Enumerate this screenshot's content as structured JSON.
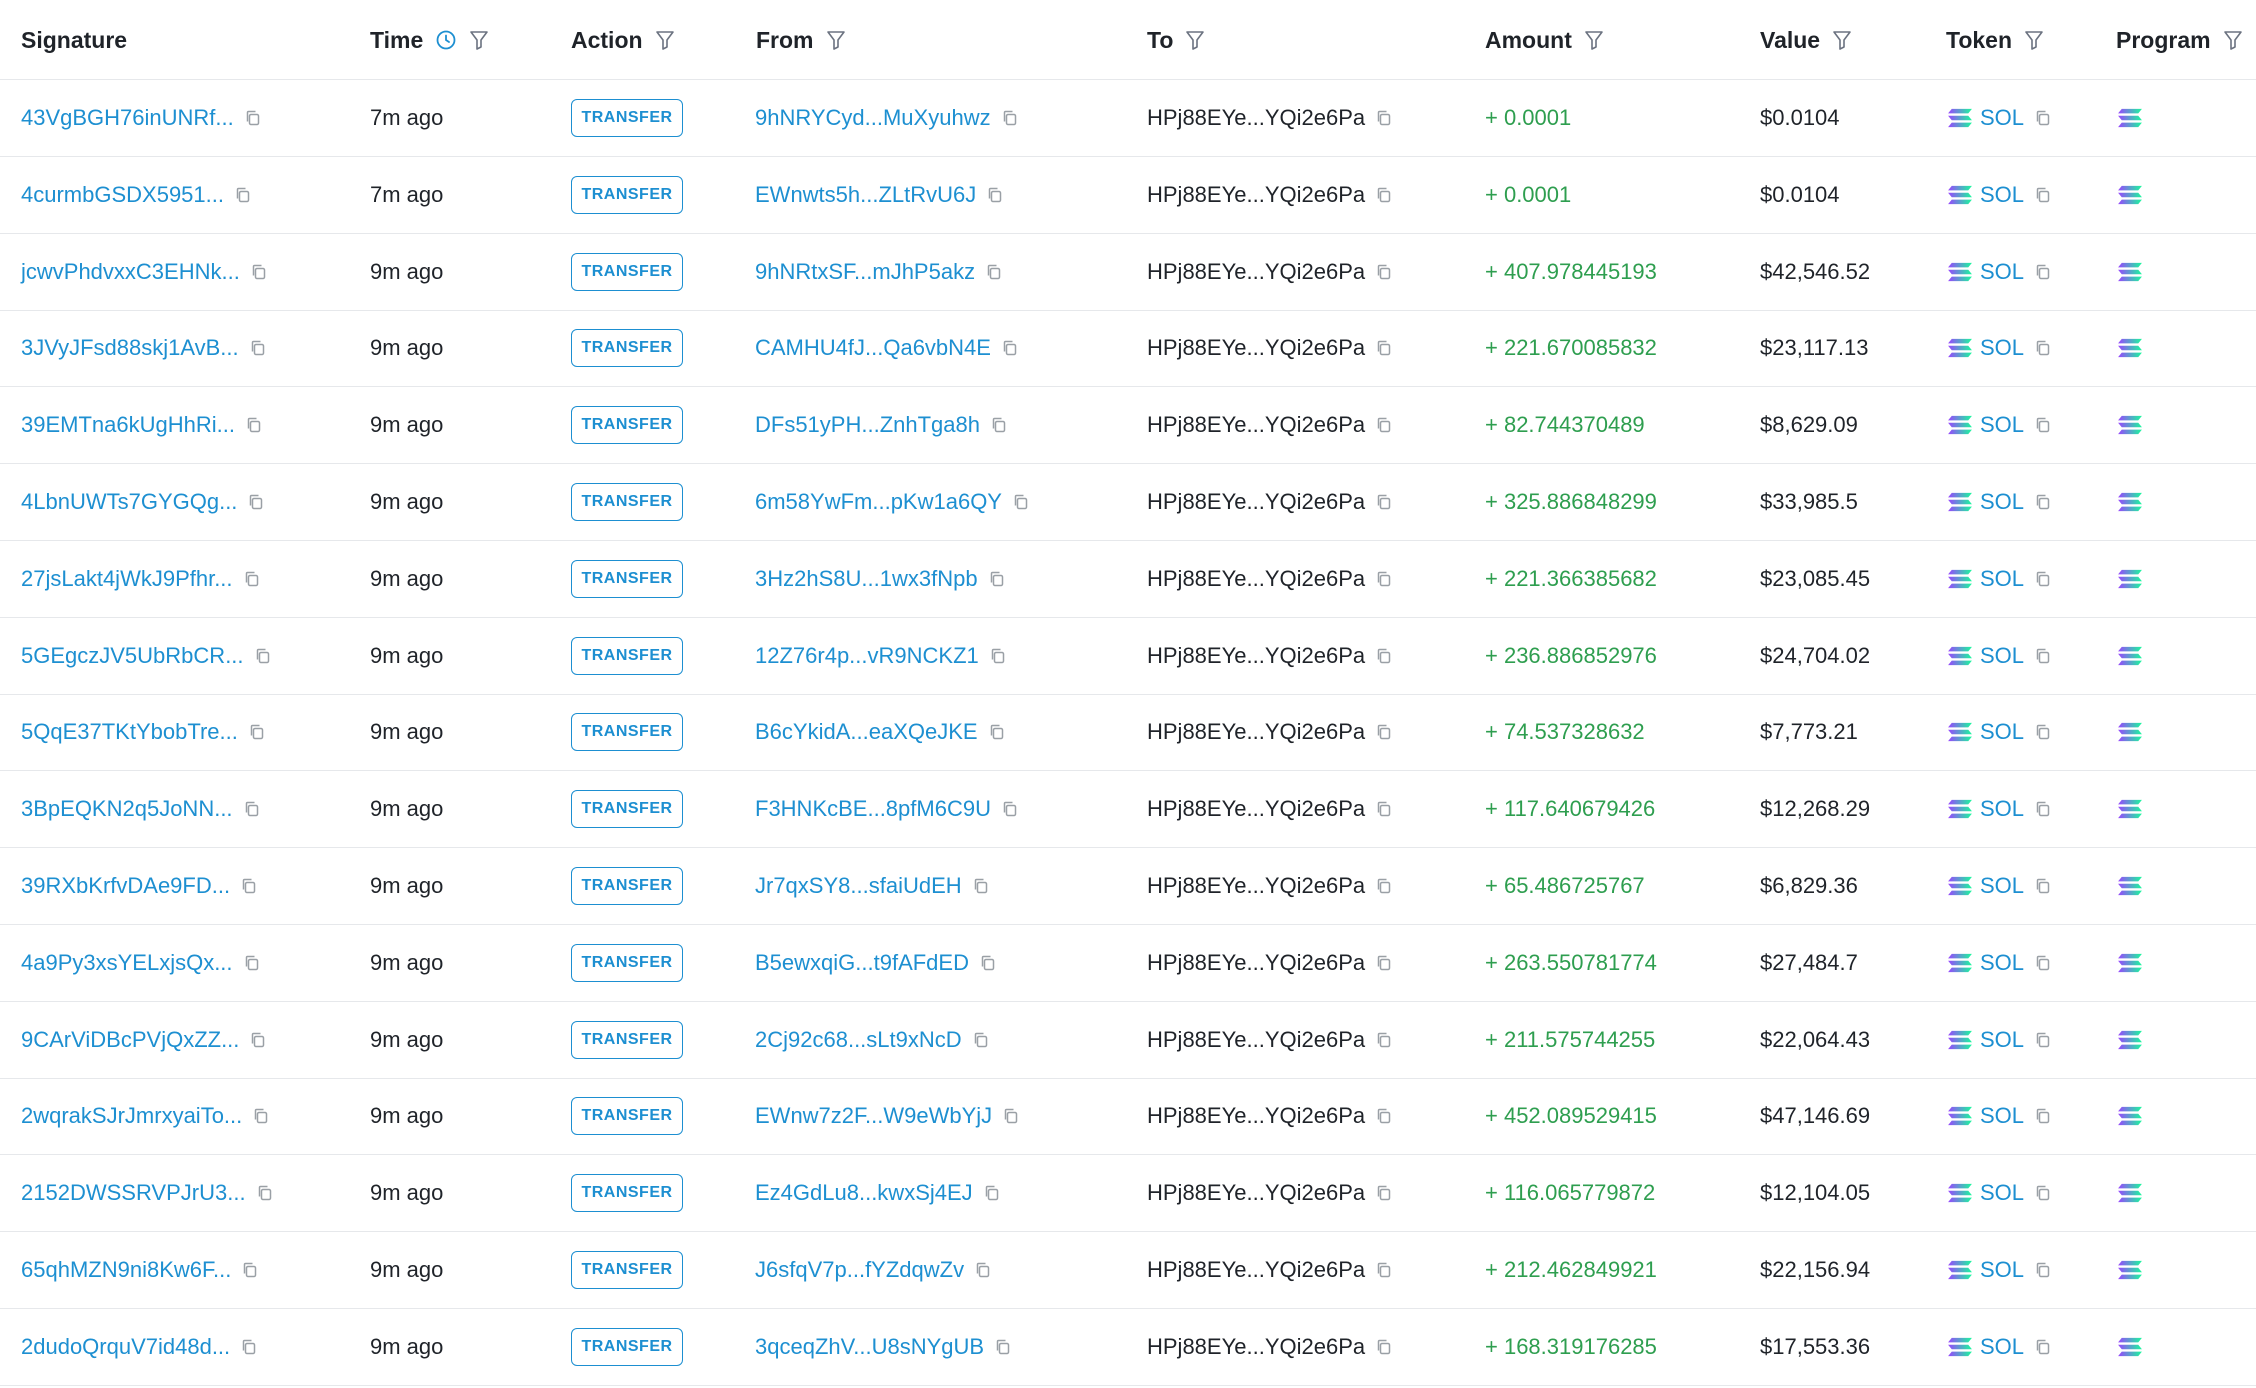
{
  "columns": {
    "signature": "Signature",
    "time": "Time",
    "action": "Action",
    "from": "From",
    "to": "To",
    "amount": "Amount",
    "value": "Value",
    "token": "Token",
    "program": "Program"
  },
  "colors": {
    "link": "#1d8fd1",
    "positive": "#2e9e4f",
    "divider": "#e6e8eb",
    "sol_gradient": [
      "#9945ff",
      "#19fb9b"
    ]
  },
  "rows": [
    {
      "signature": "43VgBGH76inUNRf...",
      "time": "7m ago",
      "action": "TRANSFER",
      "from": "9hNRYCyd...MuXyuhwz",
      "to": "HPj88EYe...YQi2e6Pa",
      "amount": "+ 0.0001",
      "value": "$0.0104",
      "token": "SOL"
    },
    {
      "signature": "4curmbGSDX5951...",
      "time": "7m ago",
      "action": "TRANSFER",
      "from": "EWnwts5h...ZLtRvU6J",
      "to": "HPj88EYe...YQi2e6Pa",
      "amount": "+ 0.0001",
      "value": "$0.0104",
      "token": "SOL"
    },
    {
      "signature": "jcwvPhdvxxC3EHNk...",
      "time": "9m ago",
      "action": "TRANSFER",
      "from": "9hNRtxSF...mJhP5akz",
      "to": "HPj88EYe...YQi2e6Pa",
      "amount": "+ 407.978445193",
      "value": "$42,546.52",
      "token": "SOL"
    },
    {
      "signature": "3JVyJFsd88skj1AvB...",
      "time": "9m ago",
      "action": "TRANSFER",
      "from": "CAMHU4fJ...Qa6vbN4E",
      "to": "HPj88EYe...YQi2e6Pa",
      "amount": "+ 221.670085832",
      "value": "$23,117.13",
      "token": "SOL"
    },
    {
      "signature": "39EMTna6kUgHhRi...",
      "time": "9m ago",
      "action": "TRANSFER",
      "from": "DFs51yPH...ZnhTga8h",
      "to": "HPj88EYe...YQi2e6Pa",
      "amount": "+ 82.744370489",
      "value": "$8,629.09",
      "token": "SOL"
    },
    {
      "signature": "4LbnUWTs7GYGQg...",
      "time": "9m ago",
      "action": "TRANSFER",
      "from": "6m58YwFm...pKw1a6QY",
      "to": "HPj88EYe...YQi2e6Pa",
      "amount": "+ 325.886848299",
      "value": "$33,985.5",
      "token": "SOL"
    },
    {
      "signature": "27jsLakt4jWkJ9Pfhr...",
      "time": "9m ago",
      "action": "TRANSFER",
      "from": "3Hz2hS8U...1wx3fNpb",
      "to": "HPj88EYe...YQi2e6Pa",
      "amount": "+ 221.366385682",
      "value": "$23,085.45",
      "token": "SOL"
    },
    {
      "signature": "5GEgczJV5UbRbCR...",
      "time": "9m ago",
      "action": "TRANSFER",
      "from": "12Z76r4p...vR9NCKZ1",
      "to": "HPj88EYe...YQi2e6Pa",
      "amount": "+ 236.886852976",
      "value": "$24,704.02",
      "token": "SOL"
    },
    {
      "signature": "5QqE37TKtYbobTre...",
      "time": "9m ago",
      "action": "TRANSFER",
      "from": "B6cYkidA...eaXQeJKE",
      "to": "HPj88EYe...YQi2e6Pa",
      "amount": "+ 74.537328632",
      "value": "$7,773.21",
      "token": "SOL"
    },
    {
      "signature": "3BpEQKN2q5JoNN...",
      "time": "9m ago",
      "action": "TRANSFER",
      "from": "F3HNKcBE...8pfM6C9U",
      "to": "HPj88EYe...YQi2e6Pa",
      "amount": "+ 117.640679426",
      "value": "$12,268.29",
      "token": "SOL"
    },
    {
      "signature": "39RXbKrfvDAe9FD...",
      "time": "9m ago",
      "action": "TRANSFER",
      "from": "Jr7qxSY8...sfaiUdEH",
      "to": "HPj88EYe...YQi2e6Pa",
      "amount": "+ 65.486725767",
      "value": "$6,829.36",
      "token": "SOL"
    },
    {
      "signature": "4a9Py3xsYELxjsQx...",
      "time": "9m ago",
      "action": "TRANSFER",
      "from": "B5ewxqiG...t9fAFdED",
      "to": "HPj88EYe...YQi2e6Pa",
      "amount": "+ 263.550781774",
      "value": "$27,484.7",
      "token": "SOL"
    },
    {
      "signature": "9CArViDBcPVjQxZZ...",
      "time": "9m ago",
      "action": "TRANSFER",
      "from": "2Cj92c68...sLt9xNcD",
      "to": "HPj88EYe...YQi2e6Pa",
      "amount": "+ 211.575744255",
      "value": "$22,064.43",
      "token": "SOL"
    },
    {
      "signature": "2wqrakSJrJmrxyaiTo...",
      "time": "9m ago",
      "action": "TRANSFER",
      "from": "EWnw7z2F...W9eWbYjJ",
      "to": "HPj88EYe...YQi2e6Pa",
      "amount": "+ 452.089529415",
      "value": "$47,146.69",
      "token": "SOL"
    },
    {
      "signature": "2152DWSSRVPJrU3...",
      "time": "9m ago",
      "action": "TRANSFER",
      "from": "Ez4GdLu8...kwxSj4EJ",
      "to": "HPj88EYe...YQi2e6Pa",
      "amount": "+ 116.065779872",
      "value": "$12,104.05",
      "token": "SOL"
    },
    {
      "signature": "65qhMZN9ni8Kw6F...",
      "time": "9m ago",
      "action": "TRANSFER",
      "from": "J6sfqV7p...fYZdqwZv",
      "to": "HPj88EYe...YQi2e6Pa",
      "amount": "+ 212.462849921",
      "value": "$22,156.94",
      "token": "SOL"
    },
    {
      "signature": "2dudoQrquV7id48d...",
      "time": "9m ago",
      "action": "TRANSFER",
      "from": "3qceqZhV...U8sNYgUB",
      "to": "HPj88EYe...YQi2e6Pa",
      "amount": "+ 168.319176285",
      "value": "$17,553.36",
      "token": "SOL"
    }
  ]
}
